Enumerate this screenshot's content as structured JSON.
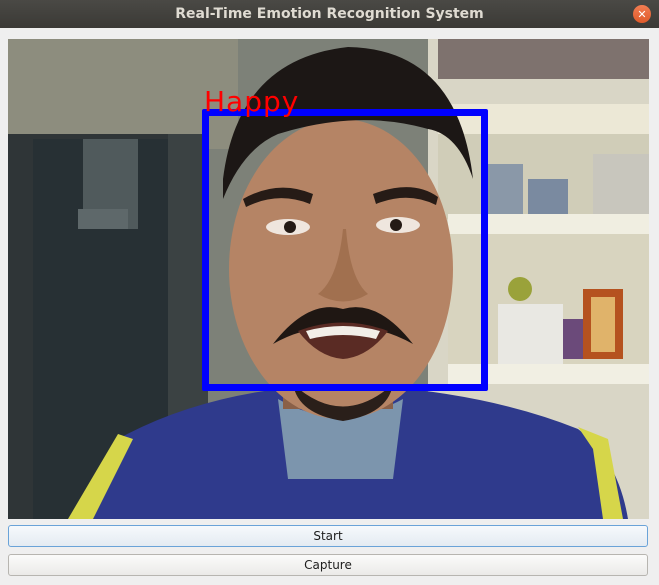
{
  "window": {
    "title": "Real-Time Emotion Recognition System",
    "close_symbol": "✕"
  },
  "video": {
    "detected_emotion": "Happy",
    "box_color": "#0000ff",
    "label_color": "#ff0000"
  },
  "buttons": {
    "start_label": "Start",
    "capture_label": "Capture"
  }
}
